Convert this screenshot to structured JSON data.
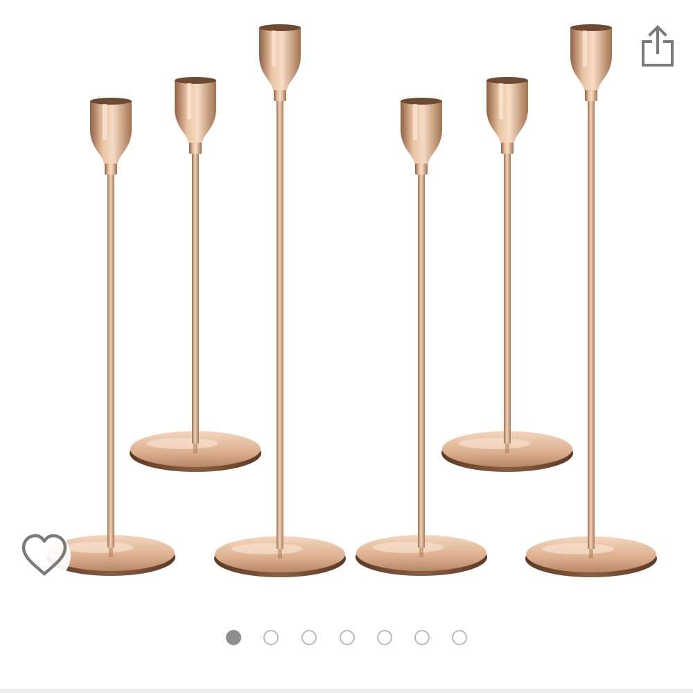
{
  "gallery": {
    "item_count": 6,
    "image_count": 7,
    "current_index": 1,
    "metal_color": "#c89a73",
    "metal_highlight": "#f3d3b6",
    "metal_shadow": "#9c6e4d"
  },
  "actions": {
    "share_icon": "share-icon",
    "favorite_icon": "heart-outline-icon"
  },
  "pager": {
    "dots": [
      {
        "state": "active"
      },
      {
        "state": "inactive"
      },
      {
        "state": "inactive"
      },
      {
        "state": "inactive"
      },
      {
        "state": "inactive"
      },
      {
        "state": "inactive"
      },
      {
        "state": "inactive"
      }
    ]
  },
  "colors": {
    "icon_gray": "#7a7a7a",
    "dot_active": "#8e8e8e",
    "dot_inactive": "#b9b9b9",
    "divider": "#ebebeb"
  }
}
